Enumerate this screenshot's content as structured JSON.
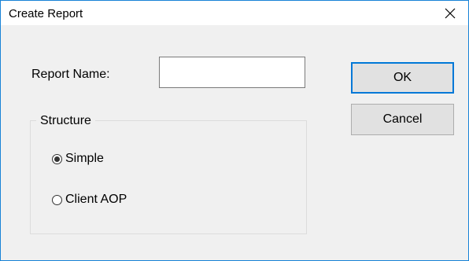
{
  "window": {
    "title": "Create Report",
    "close_icon": "close-icon"
  },
  "form": {
    "report_name_label": "Report Name:",
    "report_name_value": "",
    "structure_label": "Structure",
    "options": [
      {
        "label": "Simple",
        "selected": true
      },
      {
        "label": "Client AOP",
        "selected": false
      }
    ]
  },
  "buttons": {
    "ok_label": "OK",
    "cancel_label": "Cancel"
  },
  "colors": {
    "accent": "#0078d7",
    "window_border": "#1883d7",
    "dialog_background": "#f0f0f0"
  }
}
